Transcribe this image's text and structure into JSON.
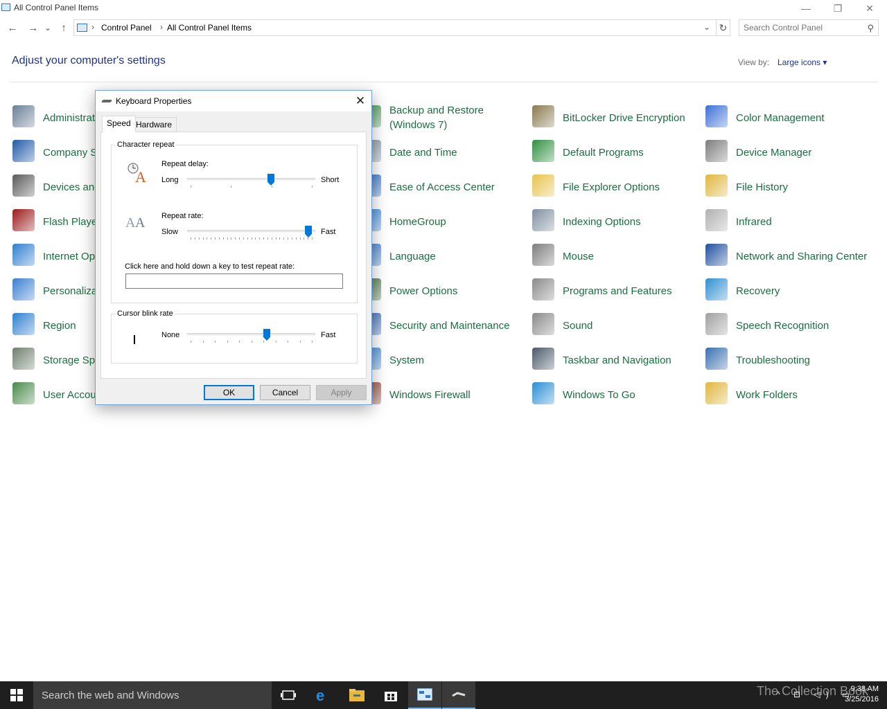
{
  "window": {
    "title": "All Control Panel Items",
    "min_glyph": "—",
    "max_glyph": "❐",
    "close_glyph": "✕"
  },
  "nav": {
    "back": "←",
    "forward": "→",
    "recent": "⌄",
    "up": "↑",
    "breadcrumb": [
      "Control Panel",
      "All Control Panel Items"
    ],
    "sep": "›",
    "dropdown": "⌄",
    "refresh": "↻",
    "search_placeholder": "Search Control Panel"
  },
  "header": {
    "title": "Adjust your computer's settings",
    "view_by_label": "View by:",
    "view_by_value": "Large icons ▾"
  },
  "items": [
    {
      "label": "Administrative Tools",
      "icon": "admin-tools-icon",
      "color": "#6a7f96"
    },
    {
      "label": "Backup and Restore (Windows 7)",
      "icon": "backup-icon",
      "color": "#3a8f4a"
    },
    {
      "label": "BitLocker Drive Encryption",
      "icon": "bitlocker-icon",
      "color": "#8a7a50"
    },
    {
      "label": "Color Management",
      "icon": "color-mgmt-icon",
      "color": "#3b6fd6"
    },
    {
      "label": "Company Settings",
      "icon": "company-icon",
      "color": "#1f5aa8"
    },
    {
      "label": "Date and Time",
      "icon": "date-time-icon",
      "color": "#7c8a9a"
    },
    {
      "label": "Default Programs",
      "icon": "default-programs-icon",
      "color": "#2f8f3f"
    },
    {
      "label": "Device Manager",
      "icon": "device-manager-icon",
      "color": "#7d7d7d"
    },
    {
      "label": "Devices and Printers",
      "icon": "devices-icon",
      "color": "#5a5a5a"
    },
    {
      "label": "Ease of Access Center",
      "icon": "ease-access-icon",
      "color": "#1e62c2"
    },
    {
      "label": "File Explorer Options",
      "icon": "folder-options-icon",
      "color": "#e8c34a"
    },
    {
      "label": "File History",
      "icon": "file-history-icon",
      "color": "#e0b63c"
    },
    {
      "label": "Flash Player",
      "icon": "flash-icon",
      "color": "#9b1a1a"
    },
    {
      "label": "HomeGroup",
      "icon": "homegroup-icon",
      "color": "#2a7fd6"
    },
    {
      "label": "Indexing Options",
      "icon": "indexing-icon",
      "color": "#7f8fa0"
    },
    {
      "label": "Infrared",
      "icon": "infrared-icon",
      "color": "#b0b0b0"
    },
    {
      "label": "Internet Options",
      "icon": "internet-icon",
      "color": "#2f7fd0"
    },
    {
      "label": "Language",
      "icon": "language-icon",
      "color": "#2a6fc8"
    },
    {
      "label": "Mouse",
      "icon": "mouse-icon",
      "color": "#7d7d7d"
    },
    {
      "label": "Network and Sharing Center",
      "icon": "network-icon",
      "color": "#1f4fa0"
    },
    {
      "label": "Personalization",
      "icon": "personalization-icon",
      "color": "#3a7fd0"
    },
    {
      "label": "Power Options",
      "icon": "power-icon",
      "color": "#3a6a3a"
    },
    {
      "label": "Programs and Features",
      "icon": "programs-icon",
      "color": "#8a8a8a"
    },
    {
      "label": "Recovery",
      "icon": "recovery-icon",
      "color": "#2f8fd0"
    },
    {
      "label": "Region",
      "icon": "region-icon",
      "color": "#2f7fd0"
    },
    {
      "label": "Security and Maintenance",
      "icon": "security-icon",
      "color": "#2a5ab0"
    },
    {
      "label": "Sound",
      "icon": "sound-icon",
      "color": "#8a8a8a"
    },
    {
      "label": "Speech Recognition",
      "icon": "speech-icon",
      "color": "#a0a0a0"
    },
    {
      "label": "Storage Spaces",
      "icon": "storage-icon",
      "color": "#6f7f6f"
    },
    {
      "label": "System",
      "icon": "system-icon",
      "color": "#2f7fd0"
    },
    {
      "label": "Taskbar and Navigation",
      "icon": "taskbar-nav-icon",
      "color": "#4a5a6a"
    },
    {
      "label": "Troubleshooting",
      "icon": "troubleshooting-icon",
      "color": "#3a6fb0"
    },
    {
      "label": "User Accounts",
      "icon": "user-accounts-icon",
      "color": "#4a8a4a"
    },
    {
      "label": "Windows Firewall",
      "icon": "firewall-icon",
      "color": "#8a3a2a"
    },
    {
      "label": "Windows To Go",
      "icon": "windows-to-go-icon",
      "color": "#2a8fd6"
    },
    {
      "label": "Work Folders",
      "icon": "work-folders-icon",
      "color": "#e0b63c"
    }
  ],
  "dialog": {
    "title": "Keyboard Properties",
    "close_glyph": "✕",
    "tabs": [
      "Speed",
      "Hardware"
    ],
    "char_repeat": {
      "legend": "Character repeat",
      "delay_label": "Repeat delay:",
      "delay_min": "Long",
      "delay_max": "Short",
      "delay_value_fraction": 0.66,
      "rate_label": "Repeat rate:",
      "rate_min": "Slow",
      "rate_max": "Fast",
      "rate_value_fraction": 0.97,
      "test_label": "Click here and hold down a key to test repeat rate:",
      "test_value": ""
    },
    "cursor_blink": {
      "legend": "Cursor blink rate",
      "min": "None",
      "max": "Fast",
      "value_fraction": 0.63
    },
    "buttons": {
      "ok": "OK",
      "cancel": "Cancel",
      "apply": "Apply"
    }
  },
  "taskbar": {
    "search_placeholder": "Search the web and Windows",
    "time": "9:38 AM",
    "date": "3/25/2016",
    "tray": "^ ⊡ ◁) ▭",
    "watermark": "The Collection Book"
  },
  "colors": {
    "link_green": "#1a6e3f",
    "title_blue": "#1e3287",
    "accent": "#0078d7",
    "taskbar": "#1f1f1f"
  }
}
